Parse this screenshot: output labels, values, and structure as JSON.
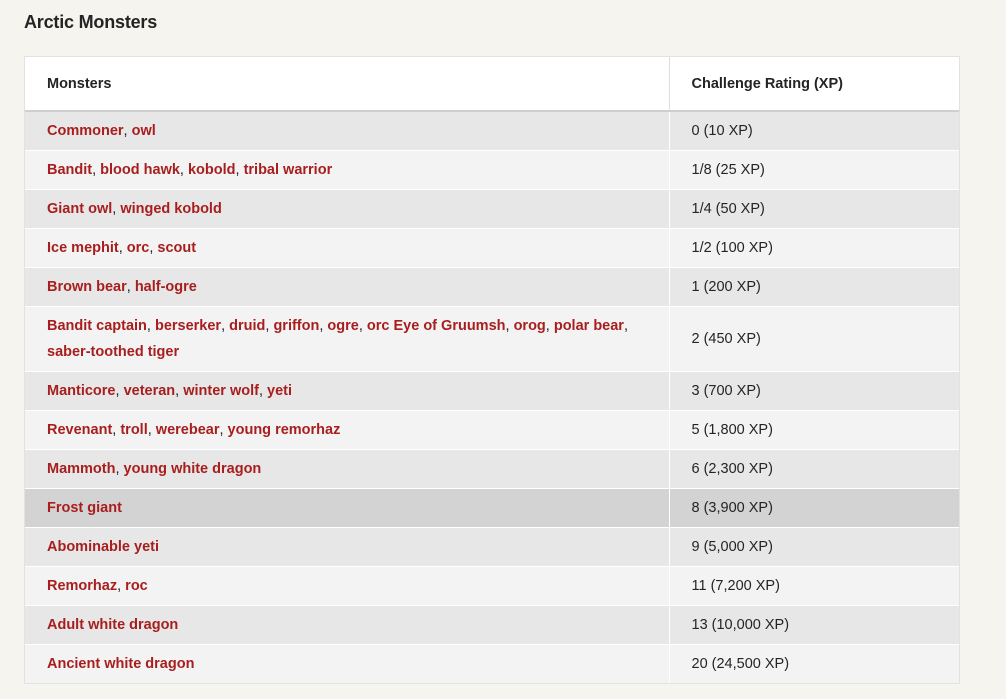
{
  "title": "Arctic Monsters",
  "table": {
    "headers": [
      "Monsters",
      "Challenge Rating (XP)"
    ],
    "rows": [
      {
        "monsters": [
          "Commoner",
          "owl"
        ],
        "cr": "0 (10 XP)"
      },
      {
        "monsters": [
          "Bandit",
          "blood hawk",
          "kobold",
          "tribal warrior"
        ],
        "cr": "1/8 (25 XP)"
      },
      {
        "monsters": [
          "Giant owl",
          "winged kobold"
        ],
        "cr": "1/4 (50 XP)"
      },
      {
        "monsters": [
          "Ice mephit",
          "orc",
          "scout"
        ],
        "cr": "1/2 (100 XP)"
      },
      {
        "monsters": [
          "Brown bear",
          "half-ogre"
        ],
        "cr": "1 (200 XP)"
      },
      {
        "monsters": [
          "Bandit captain",
          "berserker",
          "druid",
          "griffon",
          "ogre",
          "orc Eye of Gruumsh",
          "orog",
          "polar bear",
          "saber-toothed tiger"
        ],
        "cr": "2 (450 XP)"
      },
      {
        "monsters": [
          "Manticore",
          "veteran",
          "winter wolf",
          "yeti"
        ],
        "cr": "3 (700 XP)"
      },
      {
        "monsters": [
          "Revenant",
          "troll",
          "werebear",
          "young remorhaz"
        ],
        "cr": "5 (1,800 XP)"
      },
      {
        "monsters": [
          "Mammoth",
          "young white dragon"
        ],
        "cr": "6 (2,300 XP)"
      },
      {
        "monsters": [
          "Frost giant"
        ],
        "cr": "8 (3,900 XP)"
      },
      {
        "monsters": [
          "Abominable yeti"
        ],
        "cr": "9 (5,000 XP)"
      },
      {
        "monsters": [
          "Remorhaz",
          "roc"
        ],
        "cr": "11 (7,200 XP)"
      },
      {
        "monsters": [
          "Adult white dragon"
        ],
        "cr": "13 (10,000 XP)"
      },
      {
        "monsters": [
          "Ancient white dragon"
        ],
        "cr": "20 (24,500 XP)"
      }
    ]
  },
  "colors": {
    "link": "#a81e1e",
    "row_odd": "#e7e7e7",
    "row_even": "#f3f3f3",
    "row_hover": "#d3d3d3"
  },
  "hovered_row": 9,
  "separator": ", "
}
